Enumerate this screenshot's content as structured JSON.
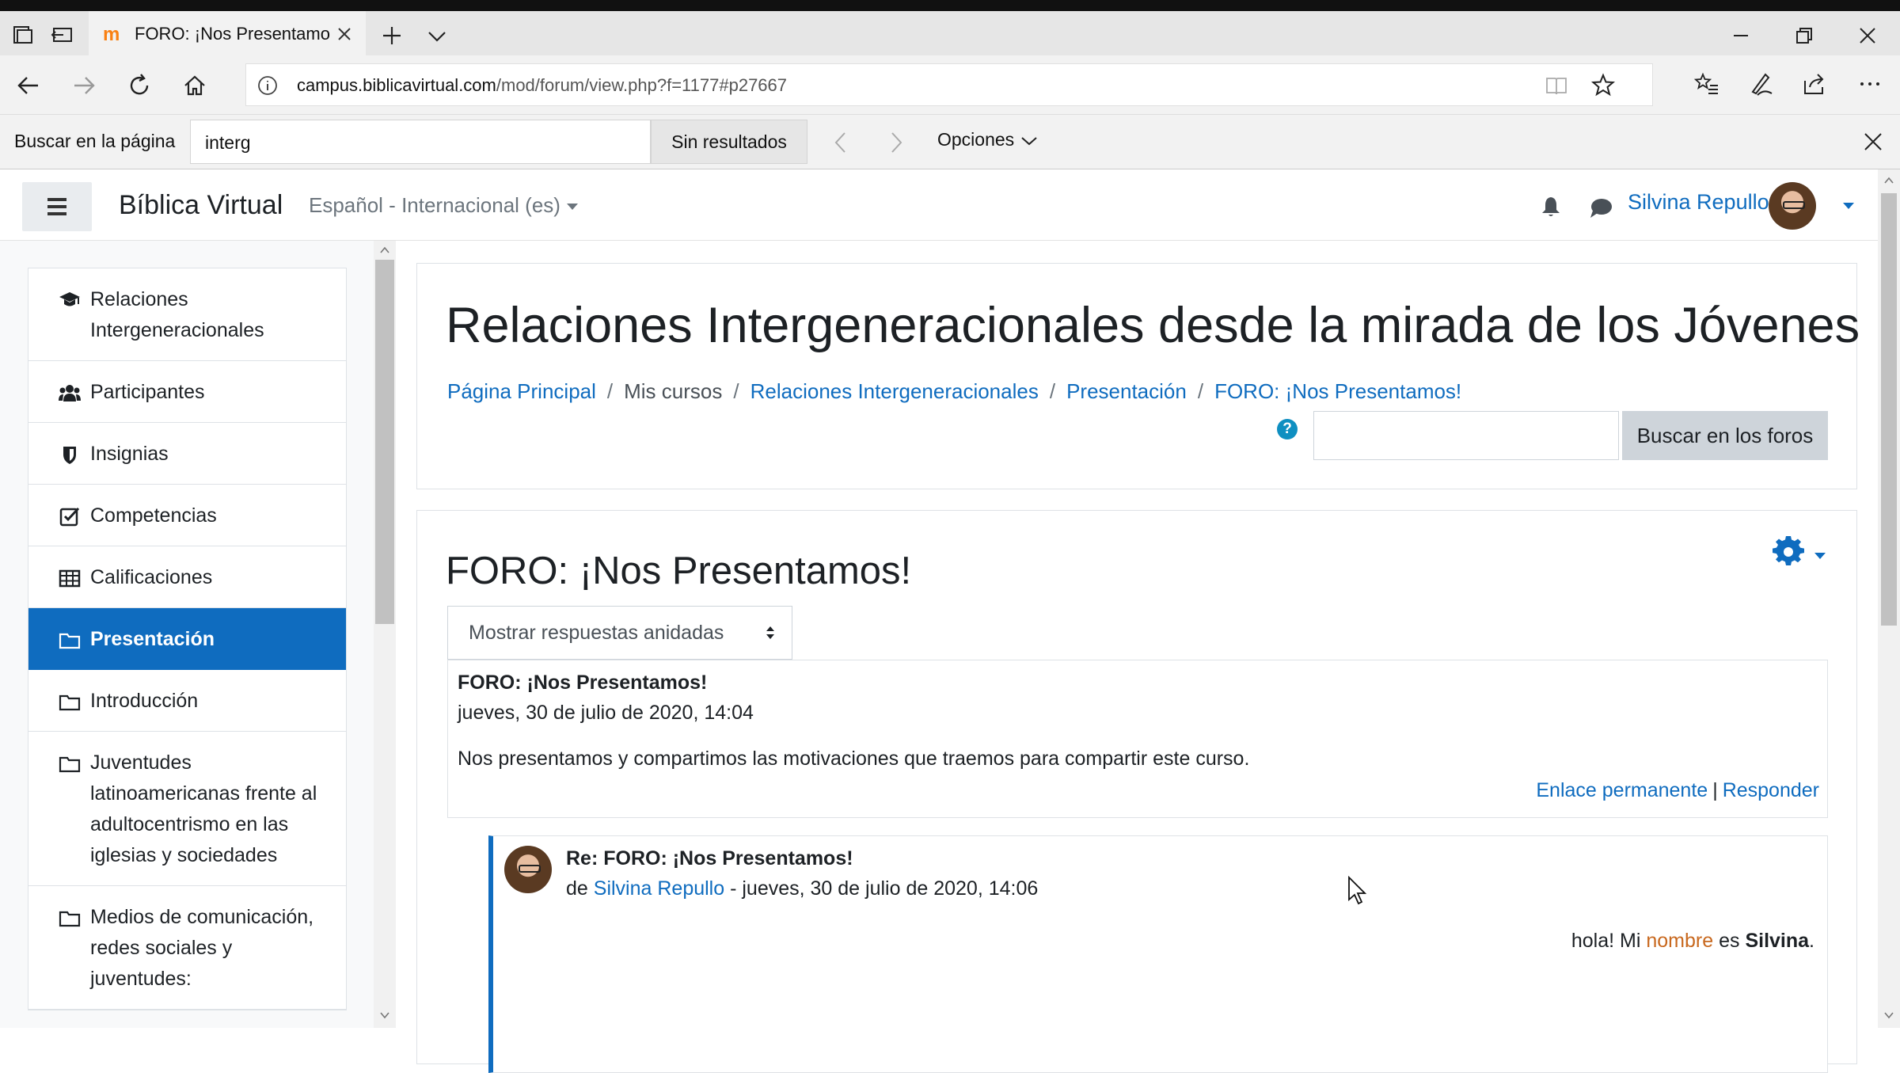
{
  "browser": {
    "tab_title": "FORO: ¡Nos Presentamo",
    "tab_favicon": "m",
    "url_domain": "campus.biblicavirtual.com",
    "url_path": "/mod/forum/view.php?f=1177#p27667"
  },
  "findbar": {
    "label": "Buscar en la página",
    "query": "interg",
    "results": "Sin resultados",
    "options": "Opciones"
  },
  "header": {
    "brand": "Bíblica Virtual",
    "language": "Español - Internacional (es)",
    "user": "Silvina Repullo"
  },
  "nav": {
    "items": [
      {
        "label": "Relaciones Intergeneracionales",
        "icon": "graduation-cap-icon"
      },
      {
        "label": "Participantes",
        "icon": "users-icon"
      },
      {
        "label": "Insignias",
        "icon": "shield-icon"
      },
      {
        "label": "Competencias",
        "icon": "check-square-icon"
      },
      {
        "label": "Calificaciones",
        "icon": "table-icon"
      },
      {
        "label": "Presentación",
        "icon": "folder-icon"
      },
      {
        "label": "Introducción",
        "icon": "folder-icon"
      },
      {
        "label": "Juventudes latinoamericanas frente al adultocentrismo en las iglesias y sociedades",
        "icon": "folder-icon"
      },
      {
        "label": "Medios de comunicación, redes sociales y juventudes:",
        "icon": "folder-icon"
      }
    ]
  },
  "page": {
    "title": "Relaciones Intergeneracionales desde la mirada de los Jóvenes",
    "breadcrumb": [
      "Página Principal",
      "Mis cursos",
      "Relaciones Intergeneracionales",
      "Presentación",
      "FORO: ¡Nos Presentamos!"
    ],
    "help": "?",
    "search_button": "Buscar en los foros"
  },
  "forum": {
    "title": "FORO: ¡Nos Presentamos!",
    "display_mode": "Mostrar respuestas anidadas",
    "post1": {
      "subject": "FORO: ¡Nos Presentamos!",
      "date": "jueves, 30 de julio de 2020, 14:04",
      "body": "Nos presentamos y compartimos las motivaciones que traemos para compartir este curso.",
      "permalink": "Enlace permanente",
      "separator": "|",
      "reply": "Responder"
    },
    "post2": {
      "subject": "Re: FORO: ¡Nos Presentamos!",
      "by_prefix": "de",
      "author": "Silvina Repullo",
      "date": "- jueves, 30 de julio de 2020, 14:06",
      "msg_a": "hola! Mi",
      "msg_b": "nombre",
      "msg_c": "es",
      "msg_d": "Silvina",
      "msg_e": "."
    }
  },
  "colors": {
    "accent": "#0f6cbf",
    "highlight": "#c8681e"
  }
}
